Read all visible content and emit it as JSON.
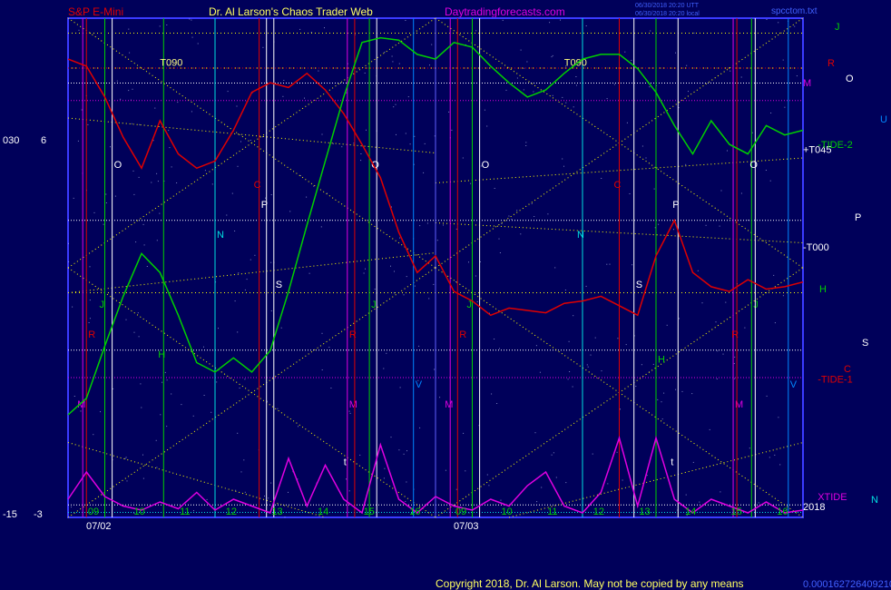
{
  "header": {
    "instrument": "S&P E-Mini",
    "site_title": "Dr. Al Larson's Chaos Trader Web",
    "site_url": "Daytradingforecasts.com",
    "timestamp_1": "06/30/2018 20:20 UTT",
    "timestamp_2": "06/30/2018 20:20 local",
    "file_name": "spcctom.txt"
  },
  "footer": {
    "copyright": "Copyright 2018, Dr. Al Larson. May not be copied by any means",
    "code": "0.000162726409210"
  },
  "left_axis": {
    "top_labels": [
      "030",
      "6"
    ],
    "bottom_labels": [
      "-15",
      "-3"
    ]
  },
  "colors": {
    "background": "#00005a",
    "plot_border": "#3b3bff",
    "red_line": "#e00000",
    "green_line": "#00d000",
    "xtide_line": "#e000e0",
    "yellow_dotted": "#ffff00",
    "white_dotted": "#ffffff",
    "magenta_dotted": "#e000e0"
  },
  "chart_data": {
    "type": "line",
    "sessions": [
      {
        "date_label": "07/02",
        "hour_ticks": [
          "09",
          "10",
          "11",
          "12",
          "13",
          "14",
          "15",
          "16"
        ]
      },
      {
        "date_label": "07/03",
        "hour_ticks": [
          "09",
          "10",
          "11",
          "12",
          "13",
          "14",
          "15",
          "16"
        ]
      }
    ],
    "series": [
      {
        "color": "#e00000",
        "values": [
          0.88,
          0.85,
          0.72,
          0.55,
          0.42,
          0.62,
          0.48,
          0.42,
          0.45,
          0.58,
          0.74,
          0.78,
          0.76,
          0.82,
          0.75,
          0.65,
          0.52,
          0.38,
          0.15,
          -0.02,
          0.05,
          -0.1,
          -0.14,
          -0.2,
          -0.17,
          -0.18,
          -0.19,
          -0.15,
          -0.14,
          -0.12,
          -0.16,
          -0.2,
          0.05,
          0.2,
          -0.02,
          -0.08,
          -0.1,
          -0.05,
          -0.09,
          -0.08,
          -0.06
        ]
      },
      {
        "color": "#00d000",
        "values": [
          -0.62,
          -0.55,
          -0.33,
          -0.12,
          0.06,
          -0.02,
          -0.2,
          -0.4,
          -0.44,
          -0.38,
          -0.44,
          -0.35,
          -0.1,
          0.18,
          0.45,
          0.72,
          0.95,
          0.97,
          0.96,
          0.9,
          0.88,
          0.95,
          0.93,
          0.85,
          0.78,
          0.72,
          0.75,
          0.82,
          0.88,
          0.9,
          0.9,
          0.84,
          0.74,
          0.6,
          0.48,
          0.62,
          0.52,
          0.48,
          0.6,
          0.56,
          0.58
        ]
      },
      {
        "name": "XTIDE",
        "color": "#e000e0",
        "values": [
          0.1,
          0.3,
          0.12,
          0.05,
          0.02,
          0.08,
          0.03,
          0.15,
          0.02,
          0.1,
          0.05,
          0.0,
          0.4,
          0.05,
          0.35,
          0.1,
          0.0,
          0.5,
          0.1,
          0.0,
          0.12,
          0.05,
          0.02,
          0.1,
          0.05,
          0.2,
          0.3,
          0.05,
          0.0,
          0.15,
          0.55,
          0.05,
          0.55,
          0.1,
          0.0,
          0.1,
          0.05,
          0.0,
          0.08,
          0.0,
          0.02
        ]
      }
    ],
    "grid": true
  },
  "vertical_lines": [
    {
      "color": "#e000e0",
      "label": "M"
    },
    {
      "color": "#e00000",
      "label": "R"
    },
    {
      "color": "#00d000",
      "label": "J"
    },
    {
      "color": "#ffffff",
      "label": "O"
    },
    {
      "color": "#00d000",
      "label": "H"
    },
    {
      "color": "#00e0e0",
      "label": "N"
    },
    {
      "color": "#ffffff",
      "label": "P"
    },
    {
      "color": "#ffffff",
      "label": "S"
    },
    {
      "color": "#e00000",
      "label": "C"
    },
    {
      "color": "#e000e0",
      "label": "M"
    },
    {
      "color": "#e00000",
      "label": "R"
    },
    {
      "color": "#00d000",
      "label": "J"
    },
    {
      "color": "#ffffff",
      "label": "O"
    },
    {
      "color": "#0088ff",
      "label": "V"
    },
    {
      "color": "#e000e0",
      "label": "M"
    },
    {
      "color": "#e00000",
      "label": "R"
    },
    {
      "color": "#00d000",
      "label": "J"
    },
    {
      "color": "#ffffff",
      "label": "O"
    },
    {
      "color": "#00e0e0",
      "label": "N"
    },
    {
      "color": "#ffffff",
      "label": "S"
    },
    {
      "color": "#e00000",
      "label": "C"
    },
    {
      "color": "#00d000",
      "label": "H"
    },
    {
      "color": "#ffffff",
      "label": "P"
    },
    {
      "color": "#e000e0",
      "label": "M"
    },
    {
      "color": "#e00000",
      "label": "R"
    },
    {
      "color": "#00d000",
      "label": "J"
    },
    {
      "color": "#ffffff",
      "label": "O"
    },
    {
      "color": "#0088ff",
      "label": "V"
    }
  ],
  "horizontal_labels": [
    {
      "text": "T090",
      "color": "#ffff80"
    },
    {
      "text": "T090",
      "color": "#ffff80"
    },
    {
      "text": "+T045",
      "color": "#ffffff"
    },
    {
      "text": "-T000",
      "color": "#ffffff"
    },
    {
      "text": "-TIDE-2",
      "color": "#00d000"
    },
    {
      "text": "-TIDE-1",
      "color": "#e00000"
    },
    {
      "text": "XTIDE",
      "color": "#e000e0"
    },
    {
      "text": "2018",
      "color": "#ffffff"
    },
    {
      "text": "t",
      "color": "#ffffff"
    },
    {
      "text": "t",
      "color": "#ffffff"
    }
  ],
  "right_legend": [
    {
      "text": "J",
      "color": "#00d000"
    },
    {
      "text": "R",
      "color": "#e00000"
    },
    {
      "text": "M",
      "color": "#e000e0"
    },
    {
      "text": "O",
      "color": "#ffffff"
    },
    {
      "text": "U",
      "color": "#0088ff"
    },
    {
      "text": "P",
      "color": "#ffffff"
    },
    {
      "text": "H",
      "color": "#00d000"
    },
    {
      "text": "S",
      "color": "#ffffff"
    },
    {
      "text": "C",
      "color": "#e00000"
    },
    {
      "text": "N",
      "color": "#00e0e0"
    }
  ]
}
